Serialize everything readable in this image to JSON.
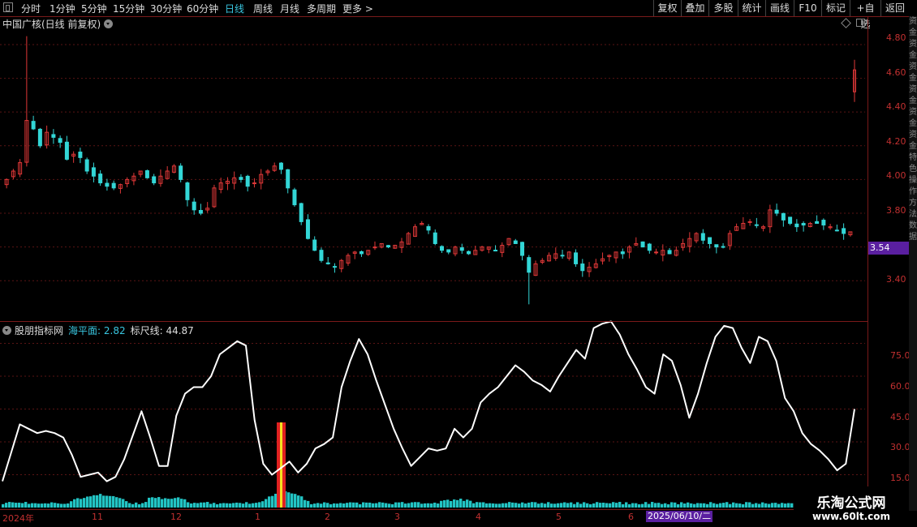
{
  "toolbar": {
    "periods": [
      "分时",
      "1分钟",
      "5分钟",
      "15分钟",
      "30分钟",
      "60分钟",
      "日线",
      "周线",
      "月线",
      "多周期",
      "更多 >"
    ],
    "active_period": "日线",
    "right_buttons": [
      "复权",
      "叠加",
      "多股",
      "统计",
      "画线",
      "F10",
      "标记",
      "+自选",
      "返回"
    ]
  },
  "stock": {
    "title": "中国广核(日线 前复权)",
    "current_price": "3.54"
  },
  "price_axis": [
    "4.80",
    "4.60",
    "4.40",
    "4.20",
    "4.00",
    "3.80",
    "3.60",
    "3.40"
  ],
  "indicator": {
    "name": "股朋指标网",
    "sea_label": "海平面: 2.82",
    "ruler_label": "标尺线: 44.87",
    "axis": [
      "75.00",
      "60.00",
      "45.00",
      "30.00",
      "15.00"
    ]
  },
  "x_axis": {
    "labels": [
      "2024年",
      "11",
      "12",
      "1",
      "2",
      "3",
      "4",
      "5",
      "6"
    ],
    "date_tag": "2025/06/10/二"
  },
  "side_text": [
    "资",
    "金",
    "资",
    "金",
    "资",
    "金",
    "资",
    "金",
    "资",
    "金",
    "资",
    "金",
    "特",
    "色",
    "操",
    "作",
    "方",
    "法",
    "数",
    "据"
  ],
  "brand": {
    "name": "乐淘公式网",
    "url": "www.60lt.com"
  },
  "colors": {
    "up": "#e03838",
    "down": "#33d6d6",
    "line": "#ffffff",
    "grid": "#5a1414",
    "accent": "#5a1fa0"
  },
  "chart_data": [
    {
      "type": "candlestick",
      "price_range": [
        3.18,
        4.92
      ],
      "close_series": [
        4.0,
        4.05,
        4.1,
        4.35,
        4.3,
        4.2,
        4.28,
        4.25,
        4.22,
        4.12,
        4.15,
        4.13,
        4.05,
        4.02,
        3.98,
        3.96,
        3.95,
        3.97,
        4.0,
        4.02,
        4.05,
        4.01,
        3.98,
        4.02,
        4.05,
        4.08,
        4.0,
        3.88,
        3.82,
        3.8,
        3.83,
        3.95,
        3.98,
        3.99,
        4.01,
        4.0,
        3.96,
        3.98,
        4.03,
        4.05,
        4.08,
        4.06,
        3.95,
        3.85,
        3.75,
        3.65,
        3.58,
        3.52,
        3.5,
        3.48,
        3.52,
        3.55,
        3.57,
        3.56,
        3.58,
        3.6,
        3.62,
        3.6,
        3.61,
        3.63,
        3.68,
        3.72,
        3.74,
        3.7,
        3.62,
        3.58,
        3.57,
        3.6,
        3.58,
        3.56,
        3.58,
        3.6,
        3.6,
        3.58,
        3.61,
        3.65,
        3.62,
        3.55,
        3.45,
        3.5,
        3.52,
        3.55,
        3.56,
        3.55,
        3.57,
        3.5,
        3.46,
        3.48,
        3.5,
        3.53,
        3.55,
        3.57,
        3.56,
        3.6,
        3.62,
        3.6,
        3.58,
        3.57,
        3.58,
        3.56,
        3.58,
        3.62,
        3.65,
        3.68,
        3.64,
        3.62,
        3.6,
        3.6,
        3.68,
        3.72,
        3.74,
        3.75,
        3.73,
        3.72,
        3.82,
        3.8,
        3.76,
        3.74,
        3.72,
        3.73,
        3.74,
        3.74,
        3.73,
        3.72,
        3.7,
        3.68,
        3.69
      ],
      "high": 4.85,
      "low": 3.26,
      "last": {
        "open": 4.52,
        "close": 4.65
      }
    },
    {
      "type": "line",
      "series": [
        {
          "name": "",
          "values": [
            12,
            25,
            38,
            36,
            34,
            35,
            34,
            32,
            24,
            14,
            15,
            16,
            12,
            14,
            22,
            33,
            44,
            32,
            19,
            19,
            42,
            52,
            55,
            55,
            60,
            70,
            73,
            76,
            74,
            40,
            20,
            15,
            18,
            21,
            16,
            20,
            27,
            29,
            32,
            55,
            67,
            77,
            70,
            58,
            47,
            36,
            27,
            19,
            23,
            27,
            26,
            27,
            36,
            32,
            36,
            48,
            52,
            55,
            60,
            65,
            62,
            58,
            56,
            53,
            60,
            66,
            72,
            68,
            82,
            84,
            85,
            79,
            70,
            63,
            55,
            52,
            70,
            67,
            56,
            41,
            52,
            66,
            78,
            83,
            82,
            73,
            66,
            78,
            76,
            67,
            50,
            44,
            34,
            29,
            26,
            22,
            17,
            20,
            45
          ]
        }
      ],
      "ylim": [
        0,
        80
      ]
    }
  ]
}
